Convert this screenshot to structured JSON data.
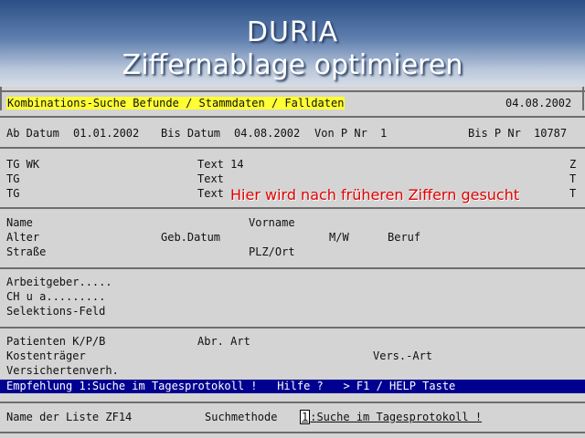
{
  "header": {
    "app_name": "DURIA",
    "subtitle": "Ziffernablage optimieren"
  },
  "title_bar": {
    "search_title": "Kombinations-Suche Befunde / Stammdaten / Falldaten",
    "date": "04.08.2002"
  },
  "range_row": {
    "ab_label": "Ab Datum",
    "ab_value": "01.01.2002",
    "bis_label": "Bis Datum",
    "bis_value": "04.08.2002",
    "von_label": "Von P Nr",
    "von_value": "1",
    "bisp_label": "Bis P Nr",
    "bisp_value": "10787"
  },
  "tg_rows": [
    {
      "left": "TG WK",
      "mid": "Text 14",
      "right": "Z"
    },
    {
      "left": "TG",
      "mid": "Text",
      "right": "T"
    },
    {
      "left": "TG",
      "mid": "Text",
      "right": "T"
    }
  ],
  "hint": "Hier wird nach früheren Ziffern gesucht",
  "person": {
    "name": "Name",
    "vorname": "Vorname",
    "alter": "Alter",
    "gebdatum": "Geb.Datum",
    "mw": "M/W",
    "beruf": "Beruf",
    "strasse": "Straße",
    "plz": "PLZ/Ort"
  },
  "employer": {
    "arbeitgeber": "Arbeitgeber.....",
    "chua": "CH u a.........",
    "selektion": "Selektions-Feld"
  },
  "patient": {
    "patienten": "Patienten K/P/B",
    "abrart": "Abr. Art",
    "kostentraeger": "Kostenträger",
    "versart": "Vers.-Art",
    "versichertenverh": "Versichertenverh."
  },
  "status_bar": {
    "text": "Empfehlung 1:Suche im Tagesprotokoll !   Hilfe ?   > F1 / HELP Taste"
  },
  "bottom": {
    "list_label": "Name der Liste ZF14",
    "method_label": "Suchmethode",
    "method_key": "1",
    "method_value": ":Suche im Tagesprotokoll !"
  }
}
